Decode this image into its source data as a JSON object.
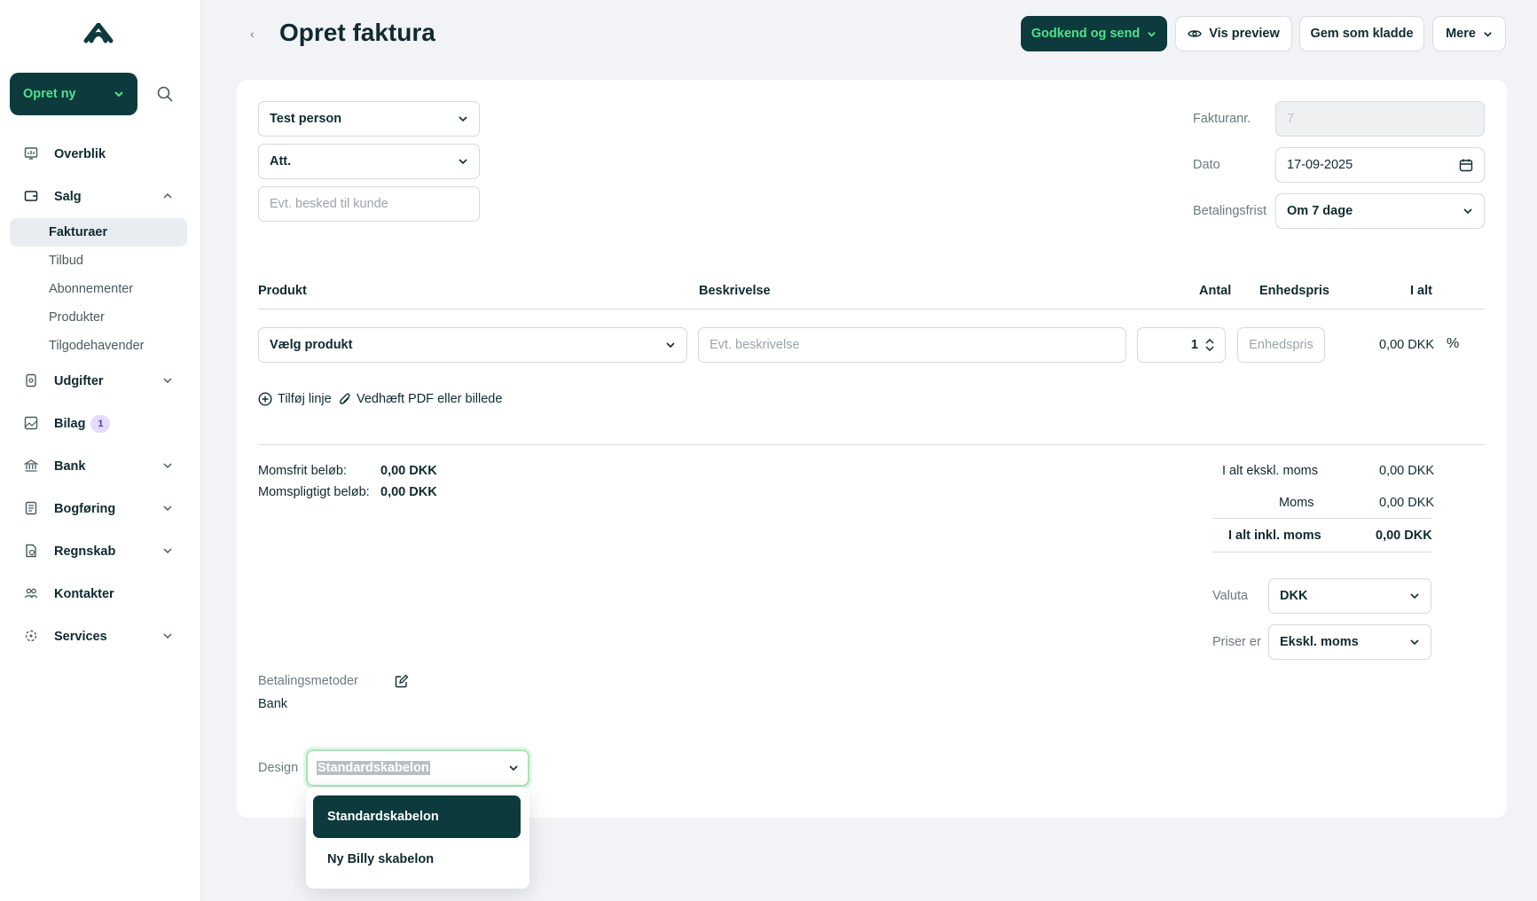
{
  "sidebar": {
    "create_label": "Opret ny",
    "items": [
      {
        "label": "Overblik",
        "icon": "dashboard-icon"
      },
      {
        "label": "Salg",
        "icon": "wallet-icon"
      },
      {
        "label": "Udgifter",
        "icon": "receipt-icon"
      },
      {
        "label": "Bilag",
        "icon": "image-icon",
        "badge": "1"
      },
      {
        "label": "Bank",
        "icon": "bank-icon"
      },
      {
        "label": "Bogføring",
        "icon": "ledger-icon"
      },
      {
        "label": "Regnskab",
        "icon": "report-icon"
      },
      {
        "label": "Kontakter",
        "icon": "people-icon"
      },
      {
        "label": "Services",
        "icon": "services-icon"
      }
    ],
    "salg_sub": [
      "Fakturaer",
      "Tilbud",
      "Abonnementer",
      "Produkter",
      "Tilgodehavender"
    ]
  },
  "header": {
    "back": "‹",
    "title": "Opret faktura",
    "approve_label": "Godkend og send",
    "preview_label": "Vis preview",
    "draft_label": "Gem som kladde",
    "more_label": "Mere"
  },
  "customer": {
    "contact": "Test person",
    "att": "Att.",
    "message_placeholder": "Evt. besked til kunde"
  },
  "meta": {
    "invoice_no_label": "Fakturanr.",
    "invoice_no": "7",
    "date_label": "Dato",
    "date": "17-09-2025",
    "due_label": "Betalingsfrist",
    "due": "Om 7 dage"
  },
  "lines": {
    "headers": {
      "product": "Produkt",
      "description": "Beskrivelse",
      "qty": "Antal",
      "unit_price": "Enhedspris",
      "total": "I alt"
    },
    "row": {
      "product": "Vælg produkt",
      "description_placeholder": "Evt. beskrivelse",
      "qty": "1",
      "unit_price_placeholder": "Enhedspris",
      "total": "0,00 DKK",
      "discount": "%"
    },
    "add_line": "Tilføj linje",
    "attach": "Vedhæft PDF eller billede"
  },
  "totals": {
    "vat_free_label": "Momsfrit beløb:",
    "vat_free": "0,00 DKK",
    "vat_liable_label": "Momspligtigt beløb:",
    "vat_liable": "0,00 DKK",
    "excl_label": "I alt ekskl. moms",
    "excl": "0,00 DKK",
    "vat_label": "Moms",
    "vat": "0,00 DKK",
    "incl_label": "I alt inkl. moms",
    "incl": "0,00 DKK"
  },
  "settings": {
    "currency_label": "Valuta",
    "currency": "DKK",
    "prices_label": "Priser er",
    "prices": "Ekskl. moms"
  },
  "payment": {
    "label": "Betalingsmetoder",
    "value": "Bank"
  },
  "design": {
    "label": "Design",
    "value": "Standardskabelon",
    "options": [
      "Standardskabelon",
      "Ny Billy skabelon"
    ]
  }
}
